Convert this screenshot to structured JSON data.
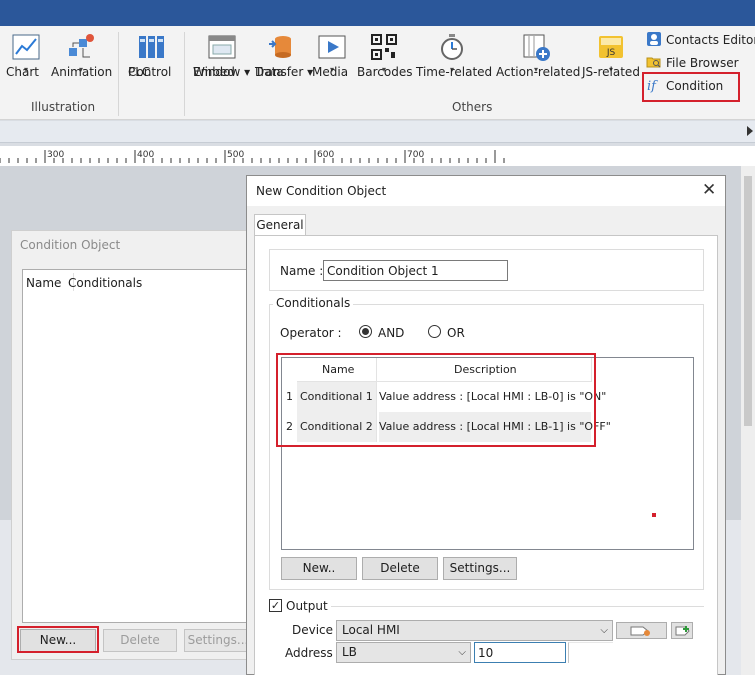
{
  "ribbon": {
    "chart": "Chart",
    "animation": "Animation",
    "illustration_group": "Illustration",
    "plc_line1": "PLC",
    "plc_line2": "Control",
    "embed_line1": "Embed",
    "embed_line2": "Window",
    "data_line1": "Data",
    "data_line2": "Transfer",
    "media": "Media",
    "barcodes": "Barcodes",
    "time_related": "Time-related",
    "action_related": "Action-related",
    "js_related": "JS-related",
    "others_group": "Others",
    "contacts_editor": "Contacts Editor",
    "file_browser": "File Browser",
    "condition": "Condition",
    "js_icon_text": "JS",
    "condition_icon_text": "if",
    "dropdown_arrow": "▾"
  },
  "ruler": {
    "marks": [
      "300",
      "400",
      "500",
      "600",
      "700"
    ]
  },
  "condition_object": {
    "title": "Condition Object",
    "col_name": "Name",
    "col_conditionals": "Conditionals",
    "new_button": "New...",
    "delete_button": "Delete",
    "settings_button": "Settings..."
  },
  "dialog": {
    "title": "New Condition Object",
    "close": "✕",
    "tab_general": "General",
    "name_label": "Name :",
    "name_value": "Condition Object 1",
    "conditionals_legend": "Conditionals",
    "operator_label": "Operator :",
    "op_and": "AND",
    "op_or": "OR",
    "col_name": "Name",
    "col_description": "Description",
    "rows": [
      {
        "num": "1",
        "name": "Conditional 1",
        "description": "Value address : [Local HMI : LB-0] is \"ON\""
      },
      {
        "num": "2",
        "name": "Conditional 2",
        "description": "Value address : [Local HMI : LB-1] is \"OFF\""
      }
    ],
    "new_button": "New..",
    "delete_button": "Delete",
    "settings_button": "Settings...",
    "output_label": "Output",
    "output_checked": "✓",
    "device_label": "Device :",
    "device_value": "Local HMI",
    "address_label": "Address :",
    "address_type": "LB",
    "address_value": "10",
    "combo_arrow": "⌵"
  },
  "colors": {
    "titlebar": "#2b579a",
    "highlight_red": "#d4202c",
    "selected_row": "#eeeeee"
  }
}
